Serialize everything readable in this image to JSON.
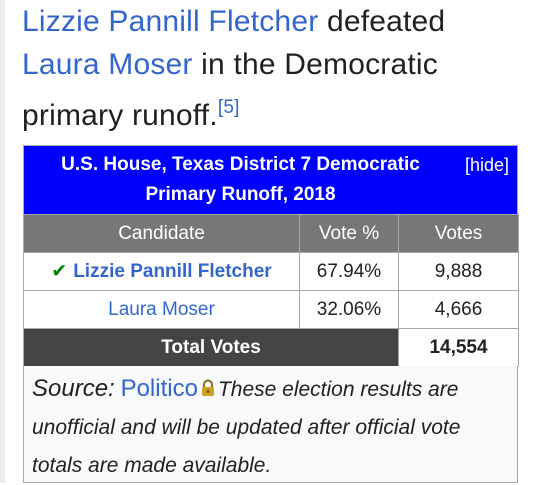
{
  "intro": {
    "winner": "Lizzie Pannill Fletcher",
    "verb": " defeated ",
    "loser": "Laura Moser",
    "rest": " in the Democratic primary runoff.",
    "ref": "[5]"
  },
  "results": {
    "caption": "U.S. House, Texas District 7 Democratic Primary Runoff, 2018",
    "hide_label": "[hide]",
    "headers": [
      "Candidate",
      "Vote %",
      "Votes"
    ],
    "rows": [
      {
        "candidate": "Lizzie Pannill Fletcher",
        "pct": "67.94%",
        "votes": "9,888",
        "winner": true
      },
      {
        "candidate": "Laura Moser",
        "pct": "32.06%",
        "votes": "4,666",
        "winner": false
      }
    ],
    "total_label": "Total Votes",
    "total_votes": "14,554",
    "colors": {
      "caption_bg": "#0000ff",
      "header_bg": "#777777",
      "total_bg": "#444444",
      "link": "#3366cc",
      "check": "#008000"
    }
  },
  "source": {
    "label": "Source:",
    "link": "Politico",
    "lock_icon": "lock-icon",
    "note": "These election results are unofficial and will be updated after official vote totals are made available."
  }
}
